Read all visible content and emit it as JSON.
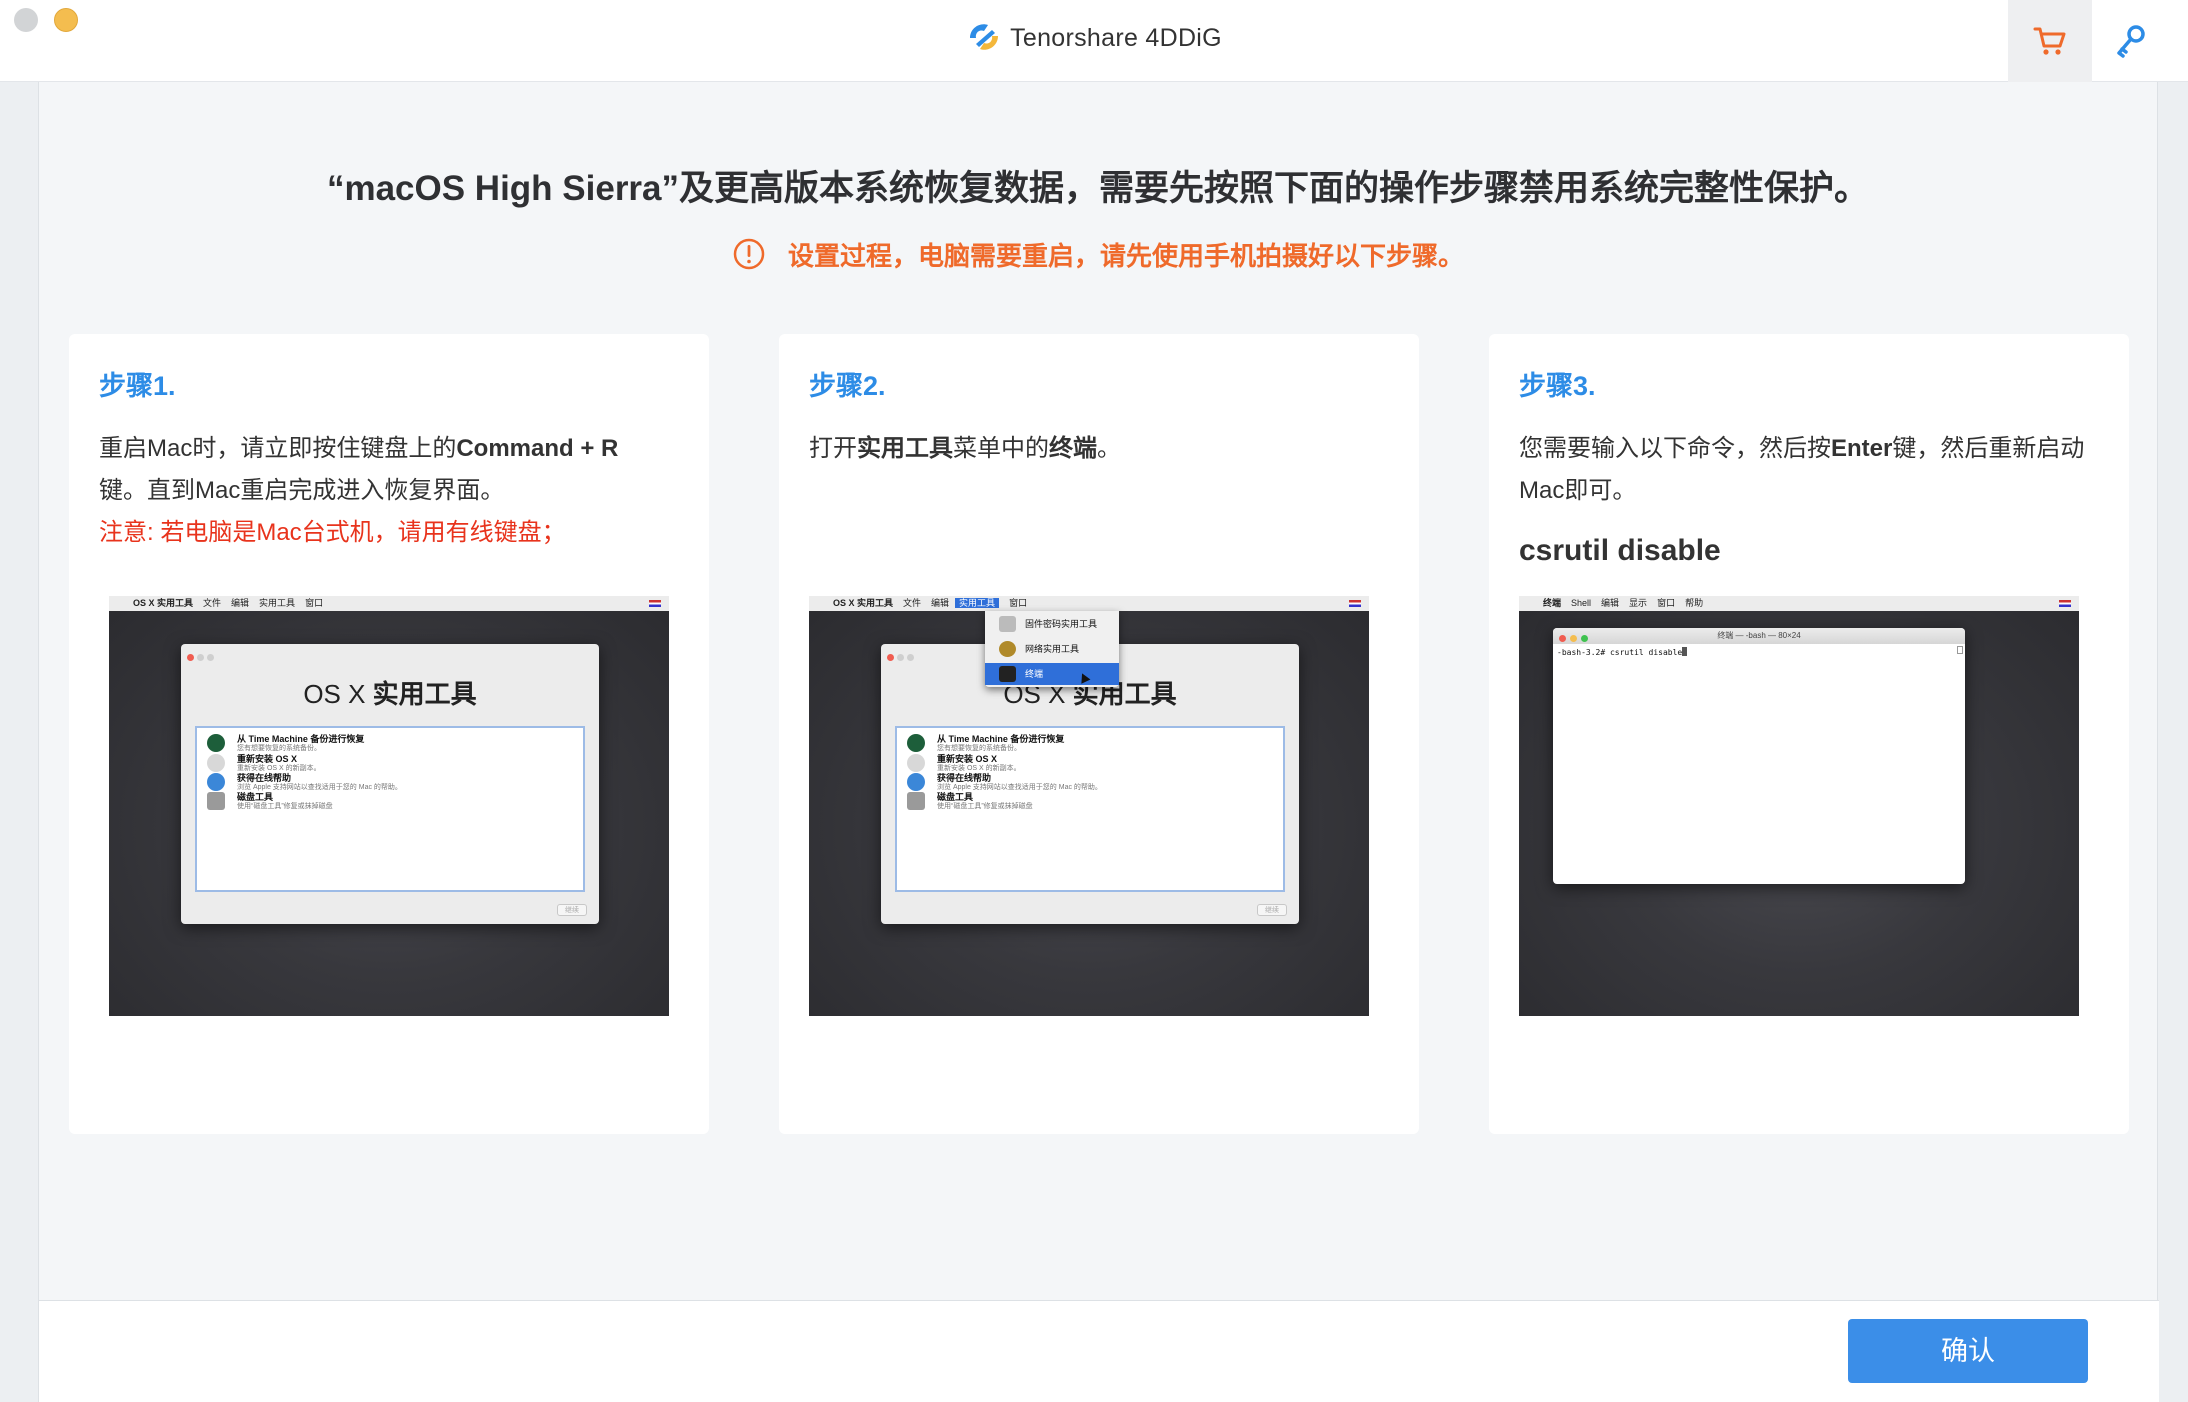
{
  "window": {
    "app_name": "Tenorshare 4DDiG",
    "logo_icon": "tenorshare-4ddig-logo",
    "cart_icon": "shopping-cart-icon",
    "key_icon": "key-icon"
  },
  "colors": {
    "accent": "#3b8ee8",
    "step_title": "#2d8ce6",
    "warning": "#ef6a2b",
    "note": "#e8331c"
  },
  "main": {
    "heading": "“macOS High Sierra”及更高版本系统恢复数据，需要先按照下面的操作步骤禁用系统完整性保护。",
    "warning": "设置过程，电脑需要重启，请先使用手机拍摄好以下步骤。"
  },
  "steps": [
    {
      "title": "步骤1.",
      "text_a": "重启Mac时，请立即按住键盘上的",
      "text_b": "Command + R",
      "text_c": "键。直到Mac重启完成进入恢复界面。",
      "note": "注意: 若电脑是Mac台式机，请用有线键盘；"
    },
    {
      "title": "步骤2.",
      "text_a": "打开",
      "text_b": "实用工具",
      "text_c": "菜单中的",
      "text_d": "终端",
      "text_e": "。"
    },
    {
      "title": "步骤3.",
      "text_a": "您需要输入以下命令，然后按",
      "text_b": "Enter",
      "text_c": "键，然后重新启动Mac即可。",
      "command": "csrutil disable"
    }
  ],
  "shots": {
    "menu_apple": "",
    "menu_utilities_app": "OS X 实用工具",
    "menu_file": "文件",
    "menu_edit": "编辑",
    "menu_utilities": "实用工具",
    "menu_window": "窗口",
    "window_title_prefix": "OS X ",
    "window_title_main": "实用工具",
    "items": [
      {
        "title": "从 Time Machine 备份进行恢复",
        "desc": "您有想要恢复的系统备份。"
      },
      {
        "title": "重新安装 OS X",
        "desc": "重新安装 OS X 的新副本。"
      },
      {
        "title": "获得在线帮助",
        "desc": "浏览 Apple 支持网站以查找适用于您的 Mac 的帮助。"
      },
      {
        "title": "磁盘工具",
        "desc": "使用“磁盘工具”修复或抹掉磁盘"
      }
    ],
    "continue_button": "继续",
    "dropdown": [
      "固件密码实用工具",
      "网络实用工具",
      "终端"
    ],
    "term_menu": [
      "终端",
      "Shell",
      "编辑",
      "显示",
      "窗口",
      "帮助"
    ],
    "term_title": "终端 — -bash — 80×24",
    "term_line": "-bash-3.2# csrutil disable"
  },
  "footer": {
    "confirm_label": "确认"
  }
}
